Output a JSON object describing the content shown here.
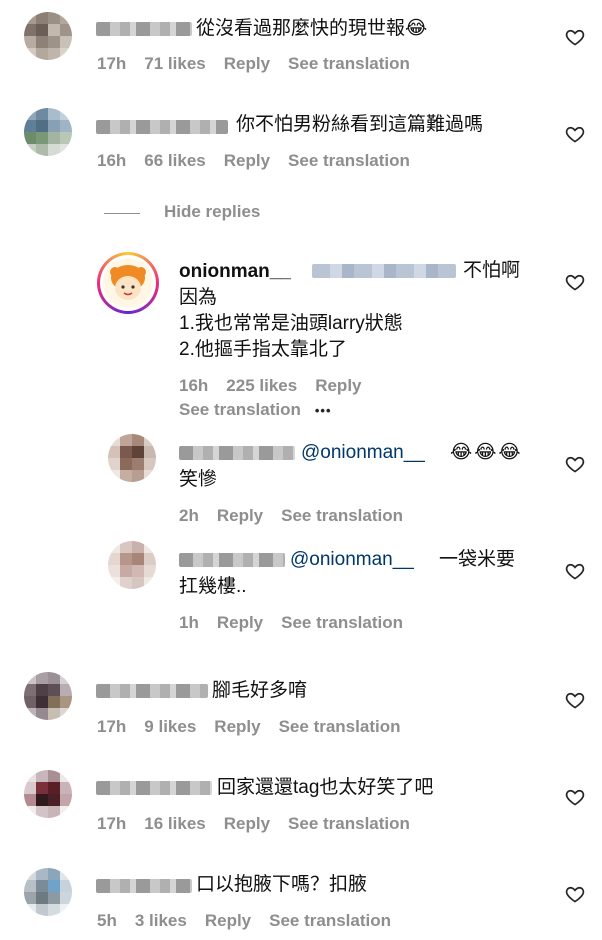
{
  "labels": {
    "reply": "Reply",
    "see_translation": "See translation",
    "hide_replies": "Hide replies",
    "more": "•••"
  },
  "comments": [
    {
      "text": "從沒看過那麼快的現世報😂",
      "time": "17h",
      "likes": "71 likes"
    },
    {
      "text": "你不怕男粉絲看到這篇難過嗎",
      "time": "16h",
      "likes": "66 likes"
    },
    {
      "text": "腳毛好多唷",
      "time": "17h",
      "likes": "9 likes"
    },
    {
      "text": "回家還還tag也太好笑了吧",
      "time": "17h",
      "likes": "16 likes"
    },
    {
      "text": "口以抱腋下嗎？扣腋",
      "time": "5h",
      "likes": "3 likes"
    }
  ],
  "owner_reply": {
    "username": "onionman__",
    "text_first": "不怕啊",
    "line2": "因為",
    "line3": "1.我也常常是油頭larry狀態",
    "line4": "2.他摳手指太靠北了",
    "time": "16h",
    "likes": "225 likes"
  },
  "replies": [
    {
      "mention": "@onionman__",
      "emoji": "😂😂😂",
      "line2": "笑慘",
      "time": "2h"
    },
    {
      "mention": "@onionman__",
      "text": "一袋米要",
      "line2": "扛幾樓..",
      "time": "1h"
    }
  ],
  "colors": {
    "text": "#111111",
    "meta": "#8e8e8e",
    "mention": "#00376b"
  },
  "icons": {
    "like": "heart-outline-icon",
    "more": "more-dots-icon"
  }
}
